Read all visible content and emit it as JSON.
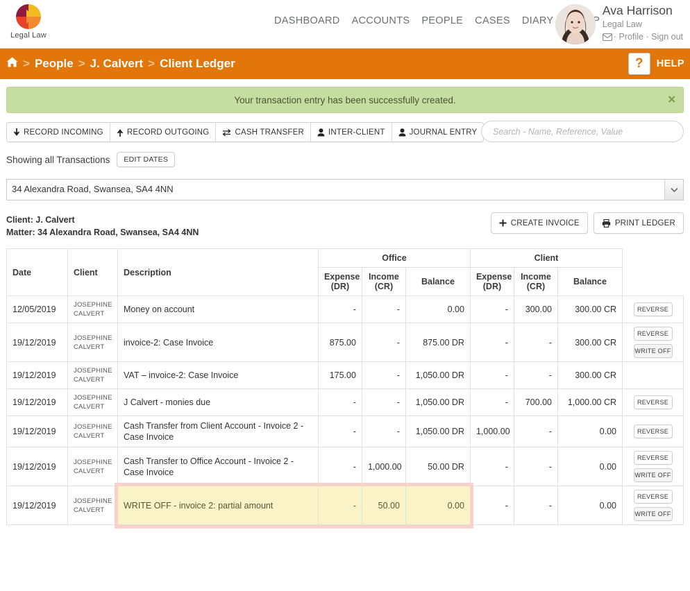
{
  "brand": {
    "name": "Legal Law",
    "logo_icon": "legal-law-logo"
  },
  "nav": {
    "items": [
      "DASHBOARD",
      "ACCOUNTS",
      "PEOPLE",
      "CASES",
      "DIARY",
      "SETUP"
    ]
  },
  "user": {
    "name": "Ava Harrison",
    "firm": "Legal Law",
    "envelope_icon": "envelope-icon",
    "sep1": "·",
    "profile": "Profile",
    "sep2": "·",
    "signout": "Sign out"
  },
  "breadcrumb": {
    "home_icon": "home-icon",
    "sep": ">",
    "items": [
      "People",
      "J. Calvert",
      "Client Ledger"
    ]
  },
  "help": {
    "icon": "question-mark-icon",
    "label": "HELP"
  },
  "alert": {
    "message": "Your transaction entry has been successfully created.",
    "close_icon": "close-icon"
  },
  "toolbar": {
    "buttons": [
      {
        "label": "RECORD INCOMING",
        "icon": "arrow-down-icon"
      },
      {
        "label": "RECORD OUTGOING",
        "icon": "arrow-up-icon"
      },
      {
        "label": "CASH TRANSFER",
        "icon": "transfer-arrows-icon"
      },
      {
        "label": "INTER-CLIENT",
        "icon": "person-icon"
      },
      {
        "label": "JOURNAL ENTRY",
        "icon": "person-icon"
      }
    ]
  },
  "search": {
    "placeholder": "Search - Name, Reference, Value",
    "value": ""
  },
  "filters": {
    "showing_label": "Showing all Transactions",
    "edit_dates_label": "EDIT DATES"
  },
  "matter_select": {
    "value": "34 Alexandra Road, Swansea, SA4 4NN",
    "chevron_icon": "chevron-down-icon"
  },
  "client_bar": {
    "client_label": "Client:",
    "client_name": "J. Calvert",
    "matter_label": "Matter:",
    "matter_value": "34 Alexandra Road, Swansea, SA4 4NN",
    "create_invoice": {
      "label": "CREATE INVOICE",
      "icon": "plus-icon"
    },
    "print_ledger": {
      "label": "PRINT LEDGER",
      "icon": "printer-icon"
    }
  },
  "ledger": {
    "group_headers": {
      "office": "Office",
      "client": "Client"
    },
    "headers": {
      "date": "Date",
      "client": "Client",
      "description": "Description",
      "expense": "Expense\n(DR)",
      "expense_l1": "Expense",
      "expense_l2": "(DR)",
      "income_l1": "Income",
      "income_l2": "(CR)",
      "balance": "Balance"
    },
    "rows": [
      {
        "date": "12/05/2019",
        "client_l1": "JOSEPHINE",
        "client_l2": "CALVERT",
        "description": "Money on account",
        "office_expense": "-",
        "office_income": "-",
        "office_balance": "0.00",
        "client_expense": "-",
        "client_income": "300.00",
        "client_balance": "300.00 CR",
        "actions": [
          "REVERSE"
        ],
        "highlight": false
      },
      {
        "date": "19/12/2019",
        "client_l1": "JOSEPHINE",
        "client_l2": "CALVERT",
        "description": "invoice-2: Case Invoice",
        "office_expense": "875.00",
        "office_income": "-",
        "office_balance": "875.00 DR",
        "client_expense": "-",
        "client_income": "-",
        "client_balance": "300.00 CR",
        "actions": [
          "REVERSE",
          "WRITE OFF"
        ],
        "highlight": false
      },
      {
        "date": "19/12/2019",
        "client_l1": "JOSEPHINE",
        "client_l2": "CALVERT",
        "description": "VAT – invoice-2: Case Invoice",
        "office_expense": "175.00",
        "office_income": "-",
        "office_balance": "1,050.00 DR",
        "client_expense": "-",
        "client_income": "-",
        "client_balance": "300.00 CR",
        "actions": [],
        "highlight": false
      },
      {
        "date": "19/12/2019",
        "client_l1": "JOSEPHINE",
        "client_l2": "CALVERT",
        "description": "J Calvert - monies due",
        "office_expense": "-",
        "office_income": "-",
        "office_balance": "1,050.00 DR",
        "client_expense": "-",
        "client_income": "700.00",
        "client_balance": "1,000.00 CR",
        "actions": [
          "REVERSE"
        ],
        "highlight": false
      },
      {
        "date": "19/12/2019",
        "client_l1": "JOSEPHINE",
        "client_l2": "CALVERT",
        "description": "Cash Transfer from Client Account - Invoice 2 - Case Invoice",
        "office_expense": "-",
        "office_income": "-",
        "office_balance": "1,050.00 DR",
        "client_expense": "1,000.00",
        "client_income": "-",
        "client_balance": "0.00",
        "actions": [
          "REVERSE"
        ],
        "highlight": false
      },
      {
        "date": "19/12/2019",
        "client_l1": "JOSEPHINE",
        "client_l2": "CALVERT",
        "description": "Cash Transfer to Office Account - Invoice 2 - Case Invoice",
        "office_expense": "-",
        "office_income": "1,000.00",
        "office_balance": "50.00 DR",
        "client_expense": "-",
        "client_income": "-",
        "client_balance": "0.00",
        "actions": [
          "REVERSE",
          "WRITE OFF"
        ],
        "highlight": false
      },
      {
        "date": "19/12/2019",
        "client_l1": "JOSEPHINE",
        "client_l2": "CALVERT",
        "description": "WRITE OFF - invoice 2: partial amount",
        "office_expense": "-",
        "office_income": "50.00",
        "office_balance": "0.00",
        "client_expense": "-",
        "client_income": "-",
        "client_balance": "0.00",
        "actions": [
          "REVERSE",
          "WRITE OFF"
        ],
        "highlight": true
      }
    ]
  },
  "colors": {
    "brand_orange": "#e2760b",
    "alert_green": "#c5dda0",
    "highlight_yellow": "#fbf3c8",
    "highlight_border": "#f6d2cd"
  }
}
